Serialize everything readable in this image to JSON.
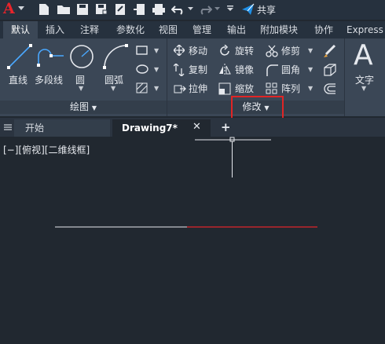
{
  "app": {
    "logo_letter": "A"
  },
  "quick_access": {
    "share_label": "共享"
  },
  "ribbon_tabs": [
    "默认",
    "插入",
    "注释",
    "参数化",
    "视图",
    "管理",
    "输出",
    "附加模块",
    "协作",
    "Express"
  ],
  "draw_panel": {
    "title": "绘图",
    "line": "直线",
    "polyline": "多段线",
    "circle": "圆",
    "arc": "圆弧"
  },
  "modify_panel": {
    "title": "修改",
    "move": "移动",
    "rotate": "旋转",
    "trim": "修剪",
    "copy": "复制",
    "mirror": "镜像",
    "fillet": "圆角",
    "stretch": "拉伸",
    "scale": "缩放",
    "array": "阵列"
  },
  "annotation_panel": {
    "text": "文字"
  },
  "doc_tabs": {
    "start": "开始",
    "drawing": "Drawing7*",
    "add": "+"
  },
  "viewport": {
    "label": "[−][俯视][二维线框]"
  },
  "colors": {
    "accent_red": "#e02525",
    "line_red": "#c0262a",
    "line_white": "#e6e9ee"
  }
}
